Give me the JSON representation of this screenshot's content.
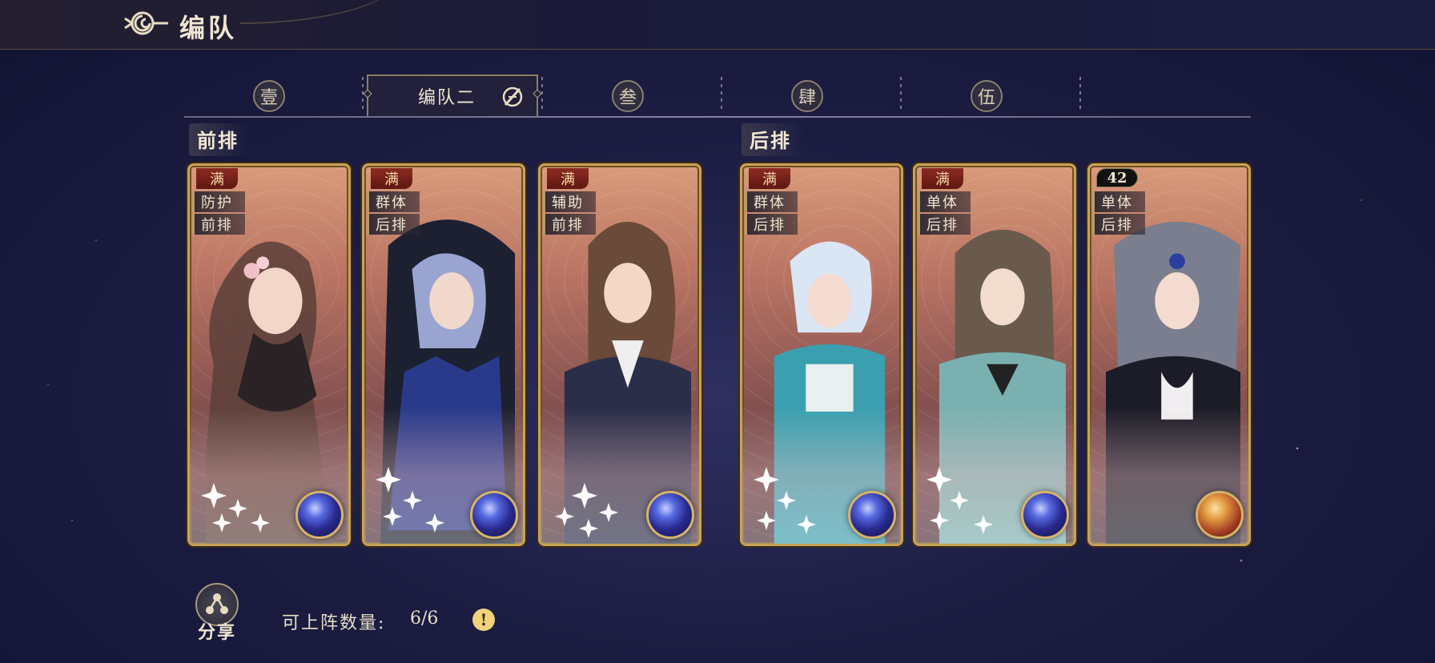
{
  "header": {
    "title": "编队"
  },
  "tabs": [
    {
      "label": "壹"
    },
    {
      "label": "编队二"
    },
    {
      "label": "叁"
    },
    {
      "label": "肆"
    },
    {
      "label": "伍"
    }
  ],
  "rows": {
    "front": "前排",
    "back": "后排"
  },
  "cards": [
    {
      "badge": "满",
      "tag1": "防护",
      "tag2": "前排",
      "orb": "blue"
    },
    {
      "badge": "满",
      "tag1": "群体",
      "tag2": "后排",
      "orb": "blue"
    },
    {
      "badge": "满",
      "tag1": "辅助",
      "tag2": "前排",
      "orb": "blue"
    },
    {
      "badge": "满",
      "tag1": "群体",
      "tag2": "后排",
      "orb": "blue"
    },
    {
      "badge": "满",
      "tag1": "单体",
      "tag2": "后排",
      "orb": "blue"
    },
    {
      "badge": "42",
      "tag1": "单体",
      "tag2": "后排",
      "orb": "red"
    }
  ],
  "footer": {
    "share_label": "分享",
    "slots_label": "可上阵数量:",
    "slots_value": "6/6",
    "info_symbol": "!"
  },
  "colors": {
    "gold": "#c8a25a",
    "badge_red": "#8c2b22",
    "bg": "#1c1d42"
  }
}
